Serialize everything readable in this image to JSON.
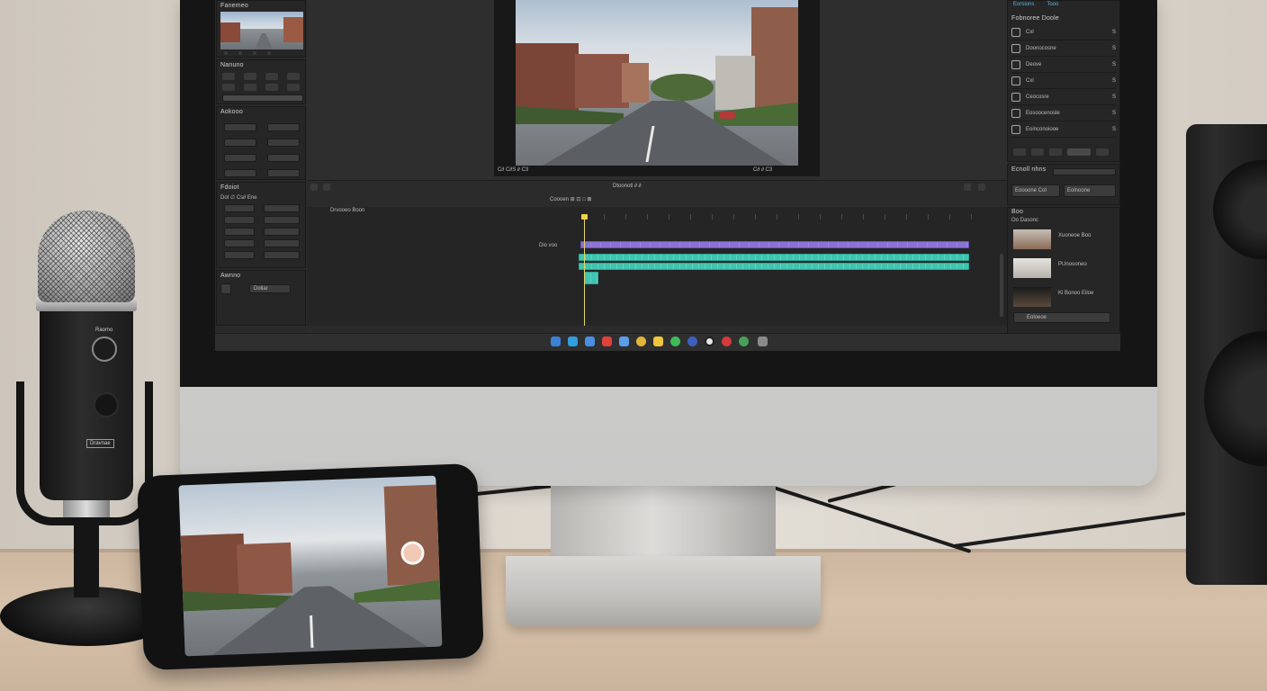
{
  "scene": "desk setup with monitor showing video editor, microphone, phone and speaker",
  "editor": {
    "left_panels": {
      "top_title": "Fanemeo",
      "panel2_title": "Nanuno",
      "panel3_title": "Aokooo",
      "panel4_title": "Fdoiot",
      "panel4_sub": "Dot ∅ Cs∂ Ene",
      "panel5_title": "Awnno",
      "panel5_select": "Dollar"
    },
    "preview": {
      "timecode_left": "C∂  C∂S ∂ C3",
      "timecode_right": "C∂  ∂ C3"
    },
    "right_panel": {
      "tabs": [
        "Eorsions",
        "Tooo"
      ],
      "section_title": "Fobnoree Doole",
      "effects": [
        {
          "label": "Cxl",
          "value": "S"
        },
        {
          "label": "Doonocosne",
          "value": "S"
        },
        {
          "label": "Deove",
          "value": "S"
        },
        {
          "label": "Cxl",
          "value": "S"
        },
        {
          "label": "Ceocosre",
          "value": "S"
        },
        {
          "label": "Eosoocenosle",
          "value": "S"
        },
        {
          "label": "Eoinconoiooe",
          "value": "S"
        }
      ],
      "export_title": "Ecnoll nhns",
      "export_buttons": [
        "Eoooone Cot",
        "Eolnoone"
      ],
      "media_title": "Boo",
      "media_sub": "Oo Dasonc",
      "media_items": [
        "Xuoneoe Boo",
        "PUnoooneo",
        "Kl Bonoo Eiloe"
      ],
      "media_footer": "Eoloeoe"
    },
    "timeline": {
      "toolbar_center": "Coooen  ⊞ ⊡ □ ⊠",
      "playhead_label": "Dtoonotl ∂ ∂",
      "sequence_name": "Drvooeo Boon",
      "track_label": "Dio voo"
    }
  },
  "microphone": {
    "label": "Dravnae",
    "top_label": "Raomo"
  },
  "colors": {
    "purple_clip": "#8a73d6",
    "teal_clip": "#3fc4b0",
    "ui_bg": "#2a2a2a",
    "panel": "#262626"
  }
}
